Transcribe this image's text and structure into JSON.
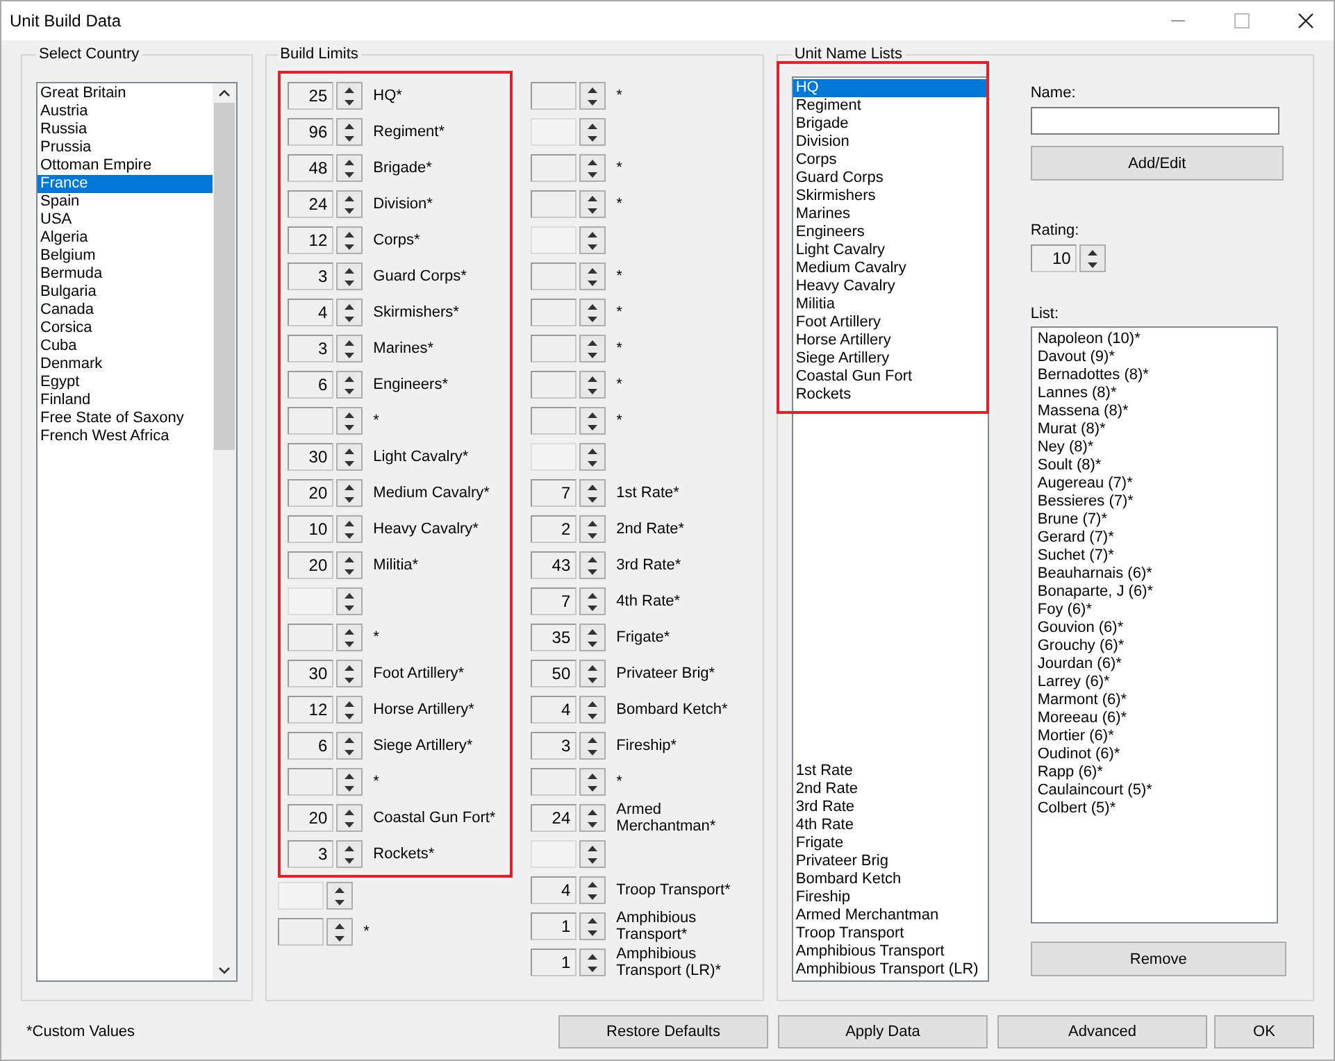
{
  "window": {
    "title": "Unit Build Data"
  },
  "select_country": {
    "title": "Select Country",
    "items": [
      {
        "text": "Great Britain",
        "selected": false
      },
      {
        "text": "Austria",
        "selected": false
      },
      {
        "text": "Russia",
        "selected": false
      },
      {
        "text": "Prussia",
        "selected": false
      },
      {
        "text": "Ottoman Empire",
        "selected": false
      },
      {
        "text": "France",
        "selected": true
      },
      {
        "text": "Spain",
        "selected": false
      },
      {
        "text": "USA",
        "selected": false
      },
      {
        "text": "Algeria",
        "selected": false
      },
      {
        "text": "Belgium",
        "selected": false
      },
      {
        "text": "Bermuda",
        "selected": false
      },
      {
        "text": "Bulgaria",
        "selected": false
      },
      {
        "text": "Canada",
        "selected": false
      },
      {
        "text": "Corsica",
        "selected": false
      },
      {
        "text": "Cuba",
        "selected": false
      },
      {
        "text": "Denmark",
        "selected": false
      },
      {
        "text": "Egypt",
        "selected": false
      },
      {
        "text": "Finland",
        "selected": false
      },
      {
        "text": "Free State of Saxony",
        "selected": false
      },
      {
        "text": "French West Africa",
        "selected": false
      }
    ]
  },
  "build_limits": {
    "title": "Build Limits",
    "columns": [
      {
        "highlighted": [
          {
            "value": "25",
            "label": "HQ*"
          },
          {
            "value": "96",
            "label": "Regiment*"
          },
          {
            "value": "48",
            "label": "Brigade*"
          },
          {
            "value": "24",
            "label": "Division*"
          },
          {
            "value": "12",
            "label": "Corps*"
          },
          {
            "value": "3",
            "label": "Guard Corps*"
          },
          {
            "value": "4",
            "label": "Skirmishers*"
          },
          {
            "value": "3",
            "label": "Marines*"
          },
          {
            "value": "6",
            "label": "Engineers*"
          },
          {
            "label": "*"
          },
          {
            "value": "30",
            "label": "Light Cavalry*"
          },
          {
            "value": "20",
            "label": "Medium Cavalry*"
          },
          {
            "value": "10",
            "label": "Heavy Cavalry*"
          },
          {
            "value": "20",
            "label": "Militia*"
          },
          {
            "kind": "empty"
          },
          {
            "label": "*"
          },
          {
            "value": "30",
            "label": "Foot Artillery*"
          },
          {
            "value": "12",
            "label": "Horse Artillery*"
          },
          {
            "value": "6",
            "label": "Siege Artillery*"
          },
          {
            "label": "*"
          },
          {
            "value": "20",
            "label": "Coastal Gun Fort*"
          },
          {
            "value": "3",
            "label": "Rockets*"
          }
        ],
        "rows": [
          {
            "kind": "empty"
          },
          {
            "label": "*"
          }
        ]
      },
      {
        "rows": [
          {
            "label": "*"
          },
          {
            "kind": "empty"
          },
          {
            "label": "*"
          },
          {
            "label": "*"
          },
          {
            "kind": "empty"
          },
          {
            "label": "*"
          },
          {
            "label": "*"
          },
          {
            "label": "*"
          },
          {
            "label": "*"
          },
          {
            "label": "*"
          },
          {
            "kind": "empty"
          },
          {
            "value": "7",
            "label": "1st Rate*"
          },
          {
            "value": "2",
            "label": "2nd Rate*"
          },
          {
            "value": "43",
            "label": "3rd Rate*"
          },
          {
            "value": "7",
            "label": "4th Rate*"
          },
          {
            "value": "35",
            "label": "Frigate*"
          },
          {
            "value": "50",
            "label": "Privateer Brig*"
          },
          {
            "value": "4",
            "label": "Bombard Ketch*"
          },
          {
            "value": "3",
            "label": "Fireship*"
          },
          {
            "label": "*"
          },
          {
            "value": "24",
            "label": "Armed Merchantman*"
          },
          {
            "kind": "empty"
          },
          {
            "value": "4",
            "label": "Troop Transport*"
          },
          {
            "value": "1",
            "label": "Amphibious Transport*"
          },
          {
            "value": "1",
            "label": "Amphibious Transport (LR)*"
          }
        ]
      }
    ]
  },
  "unit_name_lists": {
    "title": "Unit Name Lists",
    "highlighted_items": [
      {
        "text": "HQ",
        "selected": true
      },
      {
        "text": "Regiment",
        "selected": false
      },
      {
        "text": "Brigade",
        "selected": false
      },
      {
        "text": "Division",
        "selected": false
      },
      {
        "text": "Corps",
        "selected": false
      },
      {
        "text": "Guard Corps",
        "selected": false
      },
      {
        "text": "Skirmishers",
        "selected": false
      },
      {
        "text": "Marines",
        "selected": false
      },
      {
        "text": "Engineers",
        "selected": false
      },
      {
        "text": "Light Cavalry",
        "selected": false
      },
      {
        "text": "Medium Cavalry",
        "selected": false
      },
      {
        "text": "Heavy Cavalry",
        "selected": false
      },
      {
        "text": "Militia",
        "selected": false
      },
      {
        "text": "Foot Artillery",
        "selected": false
      },
      {
        "text": "Horse Artillery",
        "selected": false
      },
      {
        "text": "Siege Artillery",
        "selected": false
      },
      {
        "text": "Coastal Gun Fort",
        "selected": false
      },
      {
        "text": "Rockets",
        "selected": false
      }
    ],
    "items": [
      {
        "text": "1st Rate",
        "selected": false
      },
      {
        "text": "2nd Rate",
        "selected": false
      },
      {
        "text": "3rd Rate",
        "selected": false
      },
      {
        "text": "4th Rate",
        "selected": false
      },
      {
        "text": "Frigate",
        "selected": false
      },
      {
        "text": "Privateer Brig",
        "selected": false
      },
      {
        "text": "Bombard Ketch",
        "selected": false
      },
      {
        "text": "Fireship",
        "selected": false
      },
      {
        "text": "Armed Merchantman",
        "selected": false
      },
      {
        "text": "Troop Transport",
        "selected": false
      },
      {
        "text": "Amphibious Transport",
        "selected": false
      },
      {
        "text": "Amphibious Transport (LR)",
        "selected": false
      }
    ],
    "name_label": "Name:",
    "add_edit_button": "Add/Edit",
    "rating_label": "Rating:",
    "rating_value": "10",
    "list_label": "List:",
    "list": [
      "Napoleon (10)*",
      "Davout (9)*",
      "Bernadottes (8)*",
      "Lannes (8)*",
      "Massena (8)*",
      "Murat (8)*",
      "Ney (8)*",
      "Soult (8)*",
      "Augereau (7)*",
      "Bessieres (7)*",
      "Brune (7)*",
      "Gerard (7)*",
      "Suchet (7)*",
      "Beauharnais (6)*",
      "Bonaparte, J (6)*",
      "Foy (6)*",
      "Gouvion (6)*",
      "Grouchy (6)*",
      "Jourdan (6)*",
      "Larrey (6)*",
      "Marmont (6)*",
      "Moreeau (6)*",
      "Mortier (6)*",
      "Oudinot (6)*",
      "Rapp (6)*",
      "Caulaincourt (5)*",
      "Colbert (5)*"
    ],
    "remove_button": "Remove"
  },
  "footer": {
    "note": "*Custom Values",
    "buttons": [
      "Restore Defaults",
      "Apply Data",
      "Advanced",
      "OK"
    ]
  }
}
